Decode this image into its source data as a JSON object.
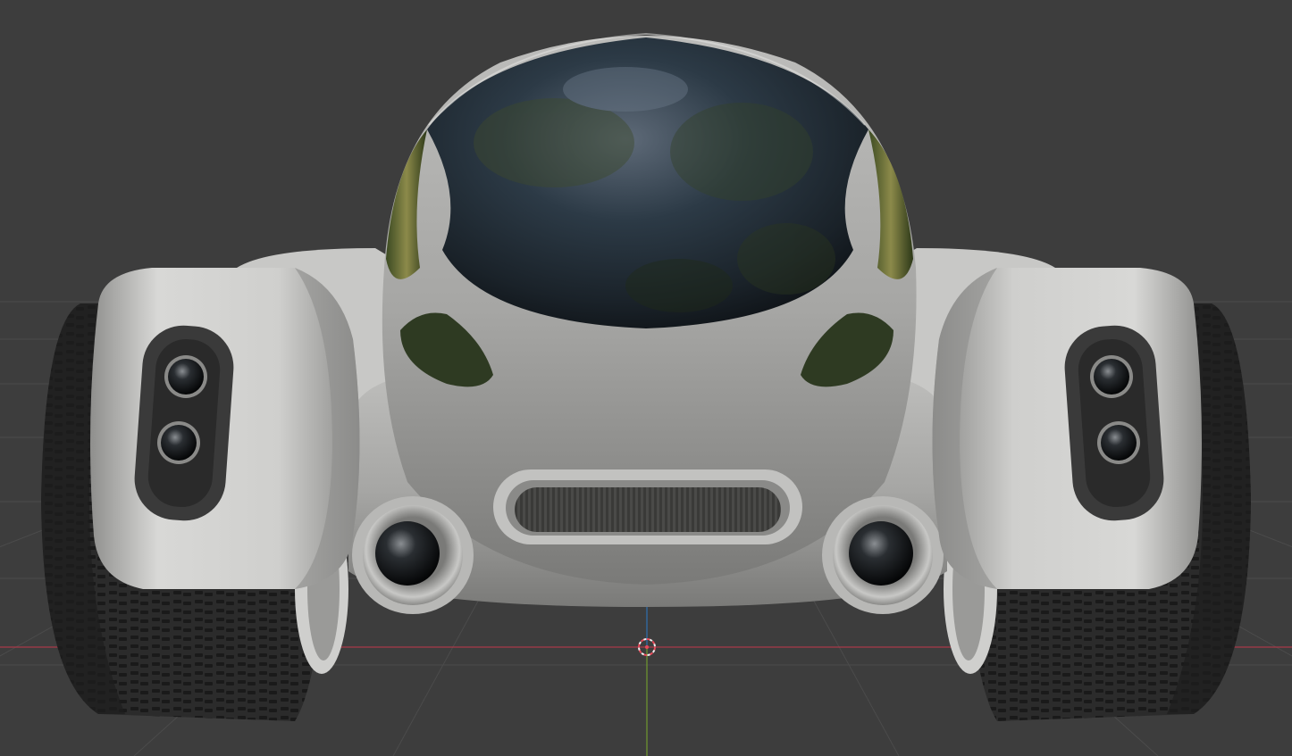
{
  "app": {
    "view": "3d-viewport",
    "shading": "rendered"
  },
  "colors": {
    "background": "#3d3d3d",
    "grid_line": "#4a4a4a",
    "x_axis": "#a83a48",
    "y_axis": "#6f9a2e",
    "z_axis": "#2e6fb0",
    "body_light": "#dcdcda",
    "body_mid": "#a8a8a6",
    "body_dark": "#6b6b69",
    "tire": "#2a2a2a",
    "glass": "#1e2a35"
  },
  "icons": {
    "cursor": "3d-cursor-icon",
    "origin": "origin-dot-icon"
  }
}
